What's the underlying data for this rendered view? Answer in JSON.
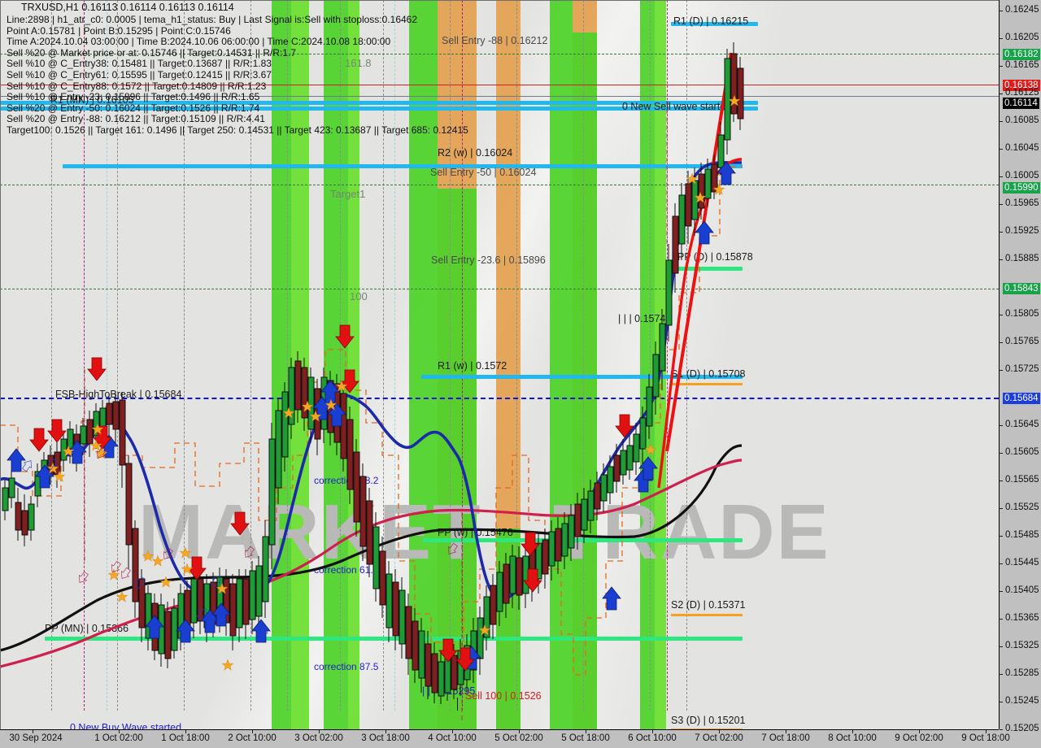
{
  "header": {
    "symbol_line": "TRXUSD,H1  0.16113 0.16114 0.16113 0.16114",
    "lines": [
      "Line:2898 |  h1_atr_c0: 0.0005 |  tema_h1_status: Buy |  Last Signal is:Sell with stoploss:0.16462",
      "Point A:0.15781 |  Point B:0.15295 |  Point C:0.15746",
      "Time A:2024.10.04 03:00:00 |  Time B:2024.10.06 06:00:00 |  Time C:2024.10.08 18:00:00",
      "Sell %20 @ Market price or at: 0.15746 ||  Target:0.14531 ||  R/R:1.7",
      "Sell %10 @ C_Entry38: 0.15481 ||  Target:0.13687 ||  R/R:1.83",
      "Sell %10 @ C_Entry61: 0.15595 ||  Target:0.12415 ||  R/R:3.67",
      "Sell %10 @ C_Entry88: 0.1572 ||  Target:0.14809 ||  R/R:1.23",
      "Sell %10 @ Entry -23: 0.15896 ||  Target:0.1496 ||  R/R:1.65",
      "Sell %20 @ Entry -50: 0.16024 ||  Target:0.1526 ||  R/R:1.74",
      "Sell %20 @ Entry -88: 0.16212 ||  Target:0.15109 ||  R/R:4.41",
      "Target100: 0.1526 ||  Target 161: 0.1496 ||  Target 250: 0.14531 ||  Target 423: 0.13687 ||  Target 685: 0.12415"
    ]
  },
  "chart_data": {
    "type": "line",
    "title": "TRXUSD,H1",
    "symbol": "TRXUSD",
    "timeframe": "H1",
    "ohlc": {
      "open": 0.16113,
      "high": 0.16114,
      "low": 0.16113,
      "close": 0.16114
    },
    "ylim": [
      0.15185,
      0.16265
    ],
    "xlabel": "",
    "ylabel": "",
    "grid": true,
    "legend": "none",
    "price_ticks": [
      "0.16245",
      "0.16205",
      "0.16165",
      "0.16125",
      "0.16085",
      "0.16045",
      "0.16005",
      "0.15965",
      "0.15925",
      "0.15885",
      "0.15845",
      "0.15805",
      "0.15765",
      "0.15725",
      "0.15645",
      "0.15605",
      "0.15565",
      "0.15525",
      "0.15485",
      "0.15445",
      "0.15405",
      "0.15365",
      "0.15325",
      "0.15285",
      "0.15245",
      "0.15205"
    ],
    "price_badges": [
      {
        "value": "0.16182",
        "kind": "green"
      },
      {
        "value": "0.16138",
        "kind": "red"
      },
      {
        "value": "0.16114",
        "kind": "black"
      },
      {
        "value": "0.15990",
        "kind": "green"
      },
      {
        "value": "0.15843",
        "kind": "green"
      },
      {
        "value": "0.15684",
        "kind": "blue"
      }
    ],
    "time_ticks": [
      "30 Sep 2024",
      "1 Oct 02:00",
      "1 Oct 18:00",
      "2 Oct 10:00",
      "3 Oct 02:00",
      "3 Oct 18:00",
      "4 Oct 10:00",
      "5 Oct 02:00",
      "5 Oct 18:00",
      "6 Oct 10:00",
      "7 Oct 02:00",
      "7 Oct 18:00",
      "8 Oct 10:00",
      "9 Oct 02:00",
      "9 Oct 18:00"
    ],
    "levels": [
      {
        "label": "R1  (D)  |  0.16215",
        "value": 0.16215,
        "color": "#22b8ee",
        "style": "blue"
      },
      {
        "label": "Sell Entry -88 | 0.16212",
        "value": 0.16212,
        "color": "#4a4a4a",
        "style": "text"
      },
      {
        "label": "0 New Sell wave started",
        "value": 0.16114,
        "color": "#22b8ee",
        "style": "blue"
      },
      {
        "label": "R1 (MN) | 0.16105",
        "value": 0.16105,
        "color": "#22b8ee",
        "style": "blue"
      },
      {
        "label": "R2 (w) | 0.16024",
        "value": 0.16024,
        "color": "#22b8ee",
        "style": "blue"
      },
      {
        "label": "Sell Entry -50 | 0.16024",
        "value": 0.16024,
        "color": "#4a4a4a",
        "style": "text"
      },
      {
        "label": "Sell Entry -23.6 | 0.15896",
        "value": 0.15896,
        "color": "#4a4a4a",
        "style": "text"
      },
      {
        "label": "PP (D) | 0.15878",
        "value": 0.15878,
        "color": "#2ee87f",
        "style": "green"
      },
      {
        "label": "S1 (D) | 0.15708",
        "value": 0.15708,
        "color": "#f5a01e",
        "style": "orange"
      },
      {
        "label": "R1 (w) | 0.1572",
        "value": 0.1572,
        "color": "#22b8ee",
        "style": "blue"
      },
      {
        "label": "FSB-HighToBreak | 0.15684",
        "value": 0.15684,
        "color": "#1111dd",
        "style": "dashblue"
      },
      {
        "label": "PP (w) | 0.15476",
        "value": 0.15476,
        "color": "#2ee87f",
        "style": "green"
      },
      {
        "label": "S2 (D) | 0.15371",
        "value": 0.15371,
        "color": "#f5a01e",
        "style": "orange"
      },
      {
        "label": "PP (MN) | 0.15366",
        "value": 0.15366,
        "color": "#2ee87f",
        "style": "green"
      },
      {
        "label": "S3 (D) | 0.15201",
        "value": 0.15201,
        "color": "#f5a01e",
        "style": "orange"
      }
    ],
    "fib_labels": [
      "161.8",
      "Target1",
      "100"
    ],
    "correction_labels": [
      "correction 38.2",
      "correction 61.8",
      "correction 87.5"
    ],
    "annotations": [
      {
        "text": "| | | 0.15746",
        "color": "#111111"
      },
      {
        "text": "| | | 0.15295",
        "color": "#2020cc"
      },
      {
        "text": "Sell 100 | 0.1526",
        "color": "#d02020"
      },
      {
        "text": "0 New Buy Wave started",
        "color": "#2020cc"
      }
    ],
    "watermark": [
      "MARKET",
      "TRADE"
    ],
    "series": [
      {
        "name": "price-candles",
        "type": "candlestick",
        "up_color": "#1f9b35",
        "down_color": "#8b1f1f"
      },
      {
        "name": "ma-blue-fast",
        "color": "#1c29a8"
      },
      {
        "name": "ma-red-slow",
        "color": "#cf1f4d"
      },
      {
        "name": "ma-black",
        "color": "#101010"
      },
      {
        "name": "trend-red-line",
        "color": "#ee1111"
      },
      {
        "name": "fractal-bands",
        "color": "#e8681c",
        "style": "dashed"
      }
    ]
  }
}
